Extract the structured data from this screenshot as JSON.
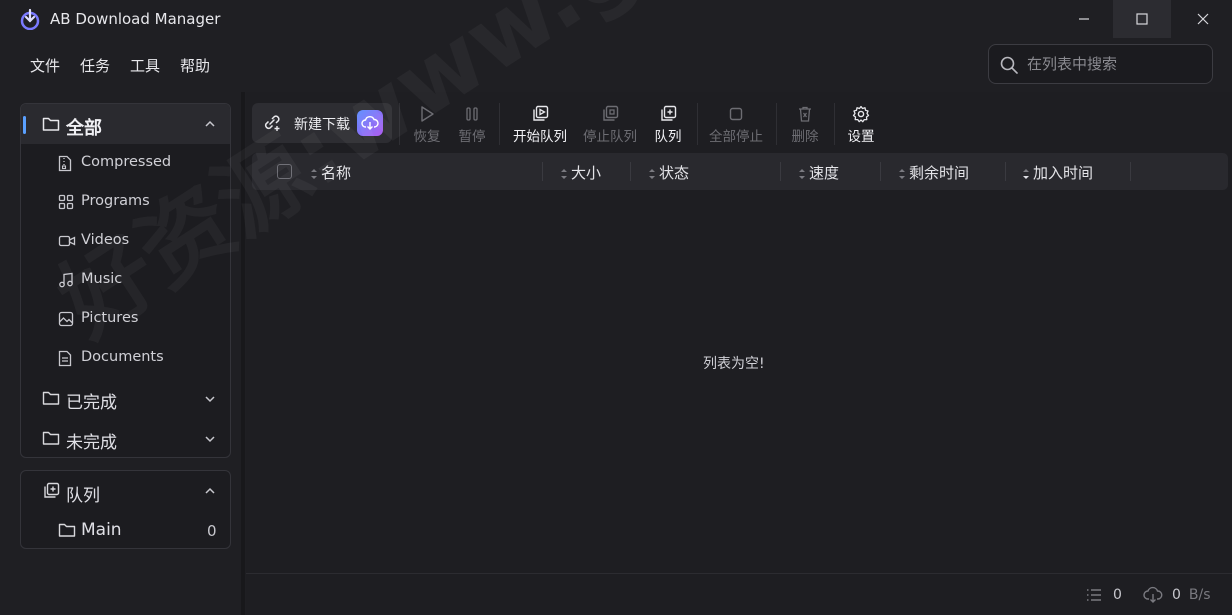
{
  "app": {
    "title": "AB Download Manager"
  },
  "menu": [
    "文件",
    "任务",
    "工具",
    "帮助"
  ],
  "search": {
    "placeholder": "在列表中搜索",
    "value": ""
  },
  "sidebar": {
    "all": {
      "label": "全部",
      "expanded": true,
      "items": [
        {
          "label": "Compressed",
          "icon": "archive-file-icon"
        },
        {
          "label": "Programs",
          "icon": "apps-grid-icon"
        },
        {
          "label": "Videos",
          "icon": "video-camera-icon"
        },
        {
          "label": "Music",
          "icon": "music-note-icon"
        },
        {
          "label": "Pictures",
          "icon": "image-icon"
        },
        {
          "label": "Documents",
          "icon": "document-icon"
        }
      ]
    },
    "finished": {
      "label": "已完成"
    },
    "unfinished": {
      "label": "未完成"
    },
    "queues": {
      "label": "队列",
      "items": [
        {
          "label": "Main",
          "count": "0"
        }
      ]
    }
  },
  "toolbar": {
    "new_download": "新建下载",
    "resume": "恢复",
    "pause": "暂停",
    "start_queue": "开始队列",
    "stop_queue": "停止队列",
    "queue": "队列",
    "stop_all": "全部停止",
    "delete": "删除",
    "settings": "设置"
  },
  "table": {
    "columns": [
      "名称",
      "大小",
      "状态",
      "速度",
      "剩余时间",
      "加入时间"
    ],
    "empty_message": "列表为空!"
  },
  "status": {
    "count": "0",
    "speed": "0",
    "speed_unit": "B/s"
  },
  "watermark": "好资源:www.goodziyuan.com",
  "colors": {
    "accent": "#5aa0ff",
    "background": "#1f1f23",
    "cloud_gradient_start": "#5b8cff",
    "cloud_gradient_end": "#b05cf0"
  }
}
